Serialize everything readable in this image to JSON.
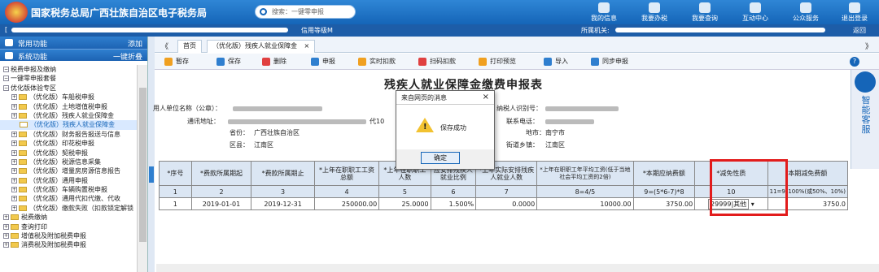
{
  "header": {
    "site_title": "国家税务总局广西壮族自治区电子税务局",
    "search_placeholder": "搜索：一键零申报",
    "nav": [
      {
        "label": "我的信息",
        "icon": "user-icon"
      },
      {
        "label": "我要办税",
        "icon": "tax-office-icon"
      },
      {
        "label": "我要查询",
        "icon": "query-icon"
      },
      {
        "label": "互动中心",
        "icon": "chat-icon"
      },
      {
        "label": "公众服务",
        "icon": "public-service-icon"
      },
      {
        "label": "退出登录",
        "icon": "logout-icon"
      }
    ]
  },
  "subbar": {
    "bracket_left": "[",
    "credit_label": "信用等级M",
    "office_label": "所属机关:",
    "back_label": "返回"
  },
  "sidebar": {
    "common_label": "常用功能",
    "add_label": "添加",
    "system_label": "系统功能",
    "fold_label": "一键折叠",
    "tree": [
      {
        "label": "税费申报及缴纳",
        "indent": 0,
        "type": "minus"
      },
      {
        "label": "一键零申报套餐",
        "indent": 0,
        "type": "minus"
      },
      {
        "label": "优化版体验专区",
        "indent": 0,
        "type": "minus"
      },
      {
        "label": "（优化版）车船税申报",
        "indent": 1,
        "type": "folder"
      },
      {
        "label": "（优化版）土地增值税申报",
        "indent": 1,
        "type": "folder"
      },
      {
        "label": "（优化版）残疾人就业保障金",
        "indent": 1,
        "type": "folder"
      },
      {
        "label": "（优化版）残疾人就业保障金",
        "indent": 2,
        "type": "sel"
      },
      {
        "label": "（优化版）财务报告报送与信息",
        "indent": 1,
        "type": "folder"
      },
      {
        "label": "（优化版）印花税申报",
        "indent": 1,
        "type": "folder"
      },
      {
        "label": "（优化版）契税申报",
        "indent": 1,
        "type": "folder"
      },
      {
        "label": "（优化版）税源信息采集",
        "indent": 1,
        "type": "folder"
      },
      {
        "label": "（优化版）增量房房源信息报告",
        "indent": 1,
        "type": "folder"
      },
      {
        "label": "（优化版）通用申报",
        "indent": 1,
        "type": "folder"
      },
      {
        "label": "（优化版）车辆购置税申报",
        "indent": 1,
        "type": "folder"
      },
      {
        "label": "（优化版）通用代扣代缴、代收",
        "indent": 1,
        "type": "folder"
      },
      {
        "label": "（优化版）缴款失败（扣款锁定解锁",
        "indent": 1,
        "type": "folder"
      },
      {
        "label": "税费缴纳",
        "indent": 0,
        "type": "folder"
      },
      {
        "label": "查询打印",
        "indent": 0,
        "type": "folder"
      },
      {
        "label": "增值税及附加税费申报",
        "indent": 0,
        "type": "folder"
      },
      {
        "label": "消费税及附加税费申报",
        "indent": 0,
        "type": "folder"
      }
    ]
  },
  "tabs": {
    "prev": "《",
    "home": "首页",
    "active": "（优化版）残疾人就业保障金",
    "close": "×",
    "next": "》"
  },
  "toolbar": {
    "buttons": [
      {
        "label": "暂存",
        "icon": "hold-icon",
        "color": "#f0a020"
      },
      {
        "label": "保存",
        "icon": "save-icon",
        "color": "#2f7fcf"
      },
      {
        "label": "删除",
        "icon": "delete-icon",
        "color": "#e04040"
      },
      {
        "label": "申报",
        "icon": "declare-icon",
        "color": "#2f7fcf"
      },
      {
        "label": "实时扣款",
        "icon": "deduct-icon",
        "color": "#f0a020"
      },
      {
        "label": "扫码扣款",
        "icon": "scan-icon",
        "color": "#e04040"
      },
      {
        "label": "打印预览",
        "icon": "print-icon",
        "color": "#f0a020"
      },
      {
        "label": "导入",
        "icon": "import-icon",
        "color": "#2f7fcf"
      },
      {
        "label": "同步申报",
        "icon": "sync-icon",
        "color": "#2f7fcf"
      }
    ],
    "help": "?"
  },
  "form": {
    "title": "残疾人就业保障金缴费申报表",
    "payer_label": "用人单位名称（公章）：",
    "address_label": "通讯地址：",
    "address_tail": "代10",
    "province_label": "省份：",
    "province_value": "广西壮族自治区",
    "district_label": "区县：",
    "district_value": "江南区",
    "taxid_label": "纳税人识别号：",
    "phone_label": "联系电话：",
    "city_label": "地市：",
    "city_value": "南宁市",
    "street_label": "街道乡镇：",
    "street_value": "江南区"
  },
  "table": {
    "headers": [
      "*序号",
      "*费款所属期起",
      "*费款所属期止",
      "*上年在职职工工资总额",
      "*上年在职职工人数",
      "应安排残疾人就业比例",
      "*上年实际安排残疾人就业人数",
      "*上年在职职工年平均工资(低于当地社会平均工资的2倍)",
      "*本期应纳费额",
      "*减免性质",
      "本期减免费额"
    ],
    "numbers": [
      "1",
      "2",
      "3",
      "4",
      "5",
      "6",
      "7",
      "8=4/5",
      "9=(5*6-7)*8",
      "10",
      "11=9*100%(或50%、10%)"
    ],
    "row": {
      "seq": "1",
      "start": "2019-01-01",
      "end": "2019-12-31",
      "salary_total": "250000.00",
      "staff": "25.0000",
      "ratio": "1.500%",
      "disabled_count": "0.0000",
      "avg_salary": "10000.00",
      "payable": "3750.00",
      "relief_code": "29999|其他",
      "relief_amount": "3750.0"
    }
  },
  "assistant": {
    "label": "智能客服"
  },
  "dialog": {
    "title": "来自网页的消息",
    "close": "×",
    "message": "保存成功",
    "ok": "确定"
  }
}
